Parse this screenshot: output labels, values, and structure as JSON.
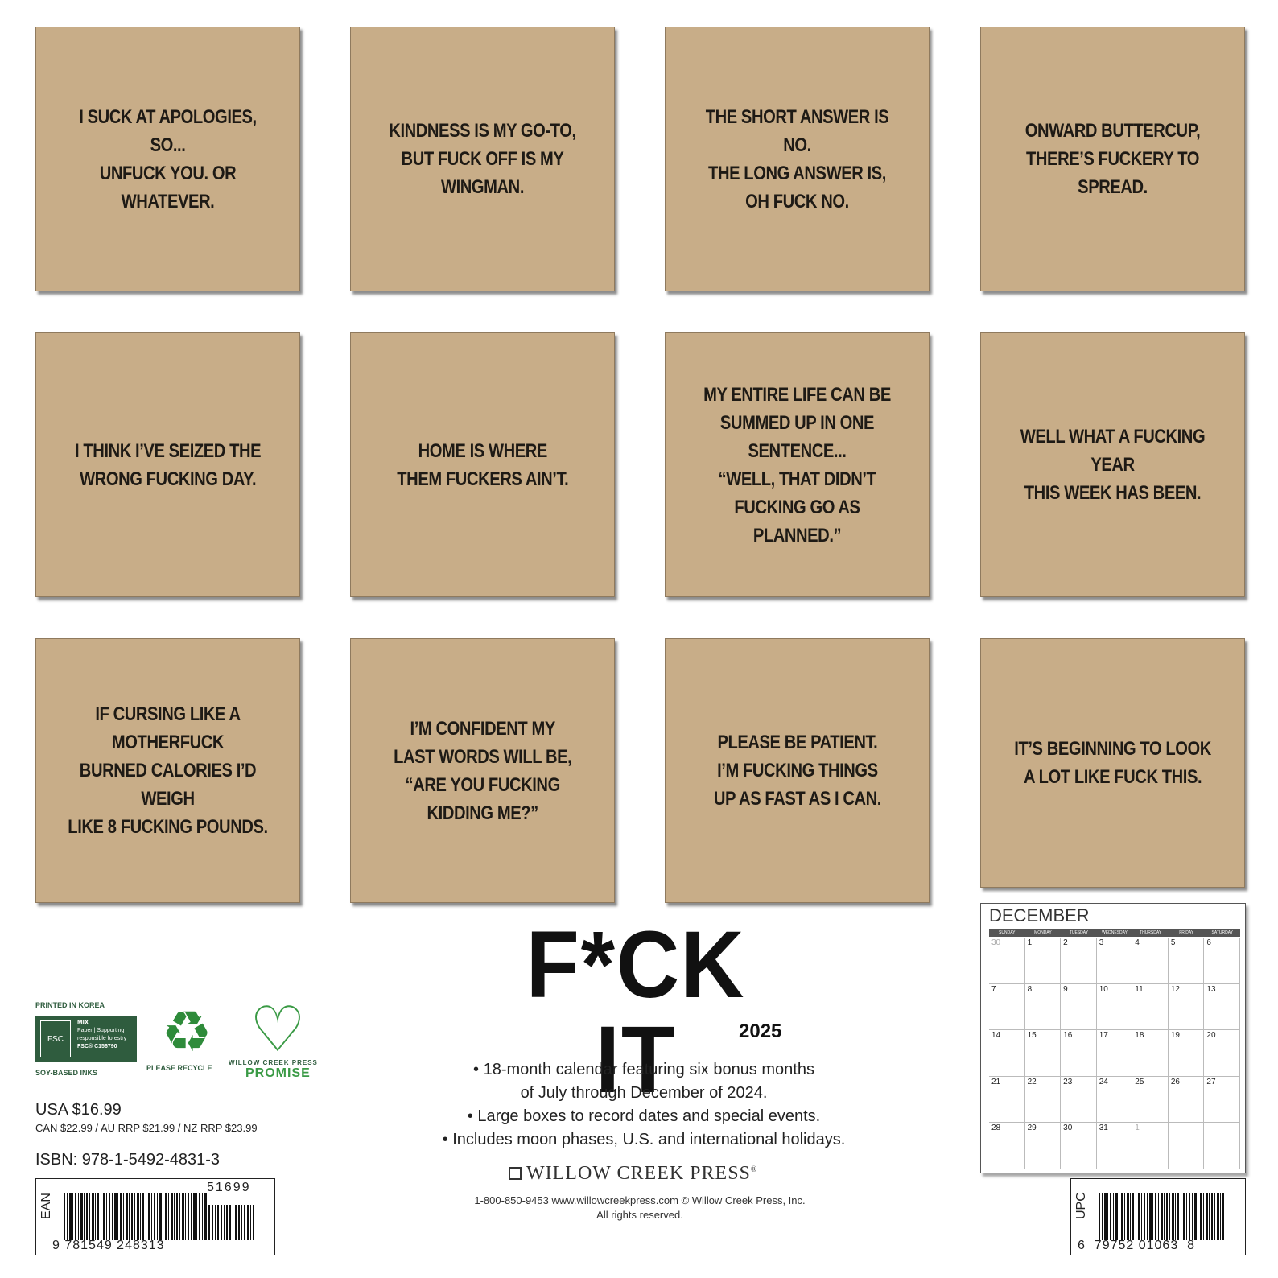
{
  "tiles": [
    "I SUCK AT APOLOGIES, SO...\nUNFUCK YOU. OR WHATEVER.",
    "KINDNESS IS MY GO-TO,\nBUT FUCK OFF IS MY WINGMAN.",
    "THE SHORT ANSWER IS NO.\nTHE LONG ANSWER IS,\nOH FUCK NO.",
    "ONWARD BUTTERCUP,\nTHERE’S FUCKERY TO SPREAD.",
    "I THINK I’VE SEIZED THE\nWRONG FUCKING DAY.",
    "HOME IS WHERE\nTHEM FUCKERS AIN’T.",
    "MY ENTIRE LIFE CAN BE\nSUMMED UP IN ONE SENTENCE...\n“WELL, THAT DIDN’T\nFUCKING GO AS PLANNED.”",
    "WELL WHAT A FUCKING YEAR\nTHIS WEEK HAS BEEN.",
    "IF CURSING LIKE A MOTHERFUCK\nBURNED CALORIES I’D WEIGH\nLIKE 8 FUCKING POUNDS.",
    "I’M CONFIDENT MY\nLAST WORDS WILL BE,\n“ARE YOU FUCKING\nKIDDING ME?”",
    "PLEASE BE PATIENT.\nI’M FUCKING THINGS\nUP AS FAST AS I CAN.",
    "IT’S BEGINNING TO LOOK\nA LOT LIKE FUCK THIS."
  ],
  "calendar": {
    "month": "DECEMBER",
    "weekdays": [
      "SUNDAY",
      "MONDAY",
      "TUESDAY",
      "WEDNESDAY",
      "THURSDAY",
      "FRIDAY",
      "SATURDAY"
    ],
    "days": [
      "30",
      "1",
      "2",
      "3",
      "4",
      "5",
      "6",
      "7",
      "8",
      "9",
      "10",
      "11",
      "12",
      "13",
      "14",
      "15",
      "16",
      "17",
      "18",
      "19",
      "20",
      "21",
      "22",
      "23",
      "24",
      "25",
      "26",
      "27",
      "28",
      "29",
      "30",
      "31",
      "1",
      "",
      ""
    ]
  },
  "product": {
    "title": "F*CK IT",
    "year": "2025",
    "bullets": [
      "• 18-month calendar featuring six bonus months",
      "of July through December of 2024.",
      "• Large boxes to record dates and special events.",
      "• Includes moon phases, U.S. and international holidays."
    ],
    "publisher": "WILLOW CREEK PRESS",
    "publisher_mark": "®",
    "contact_line1": "1-800-850-9453 www.willowcreekpress.com © Willow Creek Press, Inc.",
    "contact_line2": "All rights reserved."
  },
  "eco": {
    "printed": "PRINTED IN KOREA",
    "fsc_logo": "FSC",
    "fsc_mix": "MIX",
    "fsc_paper": "Paper | Supporting responsible forestry",
    "fsc_code": "FSC® C156790",
    "soy": "SOY-BASED INKS",
    "recycle_label": "PLEASE RECYCLE",
    "promise_top": "WILLOW CREEK PRESS",
    "promise_bottom": "PROMISE"
  },
  "pricing": {
    "usa": "USA $16.99",
    "other": "CAN $22.99 / AU RRP $21.99 / NZ RRP $23.99",
    "isbn": "ISBN: 978-1-5492-4831-3"
  },
  "barcodes": {
    "ean_label": "EAN",
    "ean_number": "9 781549 248313",
    "ean_addon": "51699",
    "upc_label": "UPC",
    "upc_number": "6  79752 01063  8"
  }
}
